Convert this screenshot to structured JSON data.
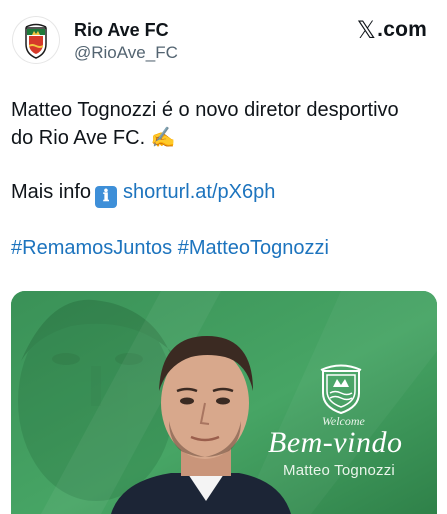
{
  "account": {
    "name": "Rio Ave FC",
    "handle": "@RioAve_FC",
    "avatar_icon": "rio-ave-crest-icon"
  },
  "source": {
    "x_glyph": "𝕏",
    "label": ".com"
  },
  "tweet": {
    "line1": "Matteo Tognozzi é o novo diretor desportivo",
    "line2": "do Rio Ave FC. ✍️",
    "more_info_label": "Mais info",
    "info_icon": "ℹ",
    "link": "shorturl.at/pX6ph",
    "hashtags": [
      "#RemamosJuntos",
      "#MatteoTognozzi"
    ]
  },
  "media": {
    "welcome": "Welcome",
    "headline": "Bem-vindo",
    "player_name": "Matteo Tognozzi",
    "crest_icon": "rio-ave-crest-icon",
    "colors": {
      "green": "#3f9a5d",
      "dark_green": "#2e7d48"
    }
  }
}
